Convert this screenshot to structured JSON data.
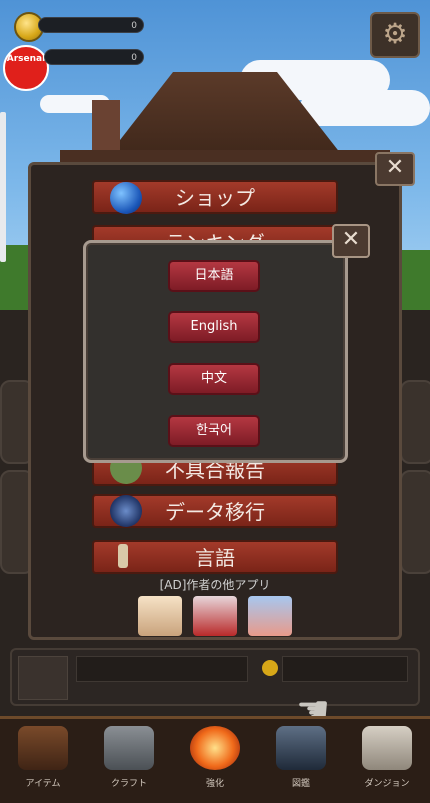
{
  "hud": {
    "coins": "0",
    "gems": "0",
    "club_badge_text": "Arsenal"
  },
  "menu": {
    "items": [
      {
        "label": "ショップ"
      },
      {
        "label": "ランキング"
      },
      {
        "label": "不具合報告"
      },
      {
        "label": "データ移行"
      },
      {
        "label": "言語"
      }
    ],
    "ad_label": "[AD]作者の他アプリ",
    "close_symbol": "✕"
  },
  "language_dialog": {
    "options": [
      {
        "label": "日本語"
      },
      {
        "label": "English"
      },
      {
        "label": "中文"
      },
      {
        "label": "한국어"
      }
    ],
    "close_symbol": "✕"
  },
  "bottom_nav": {
    "items": [
      {
        "label": "アイテム"
      },
      {
        "label": "クラフト"
      },
      {
        "label": "強化"
      },
      {
        "label": "図鑑"
      },
      {
        "label": "ダンジョン"
      }
    ]
  },
  "colors": {
    "menu_button": "#a33a2a",
    "language_button": "#b43842",
    "panel_border": "#a79a8f"
  }
}
